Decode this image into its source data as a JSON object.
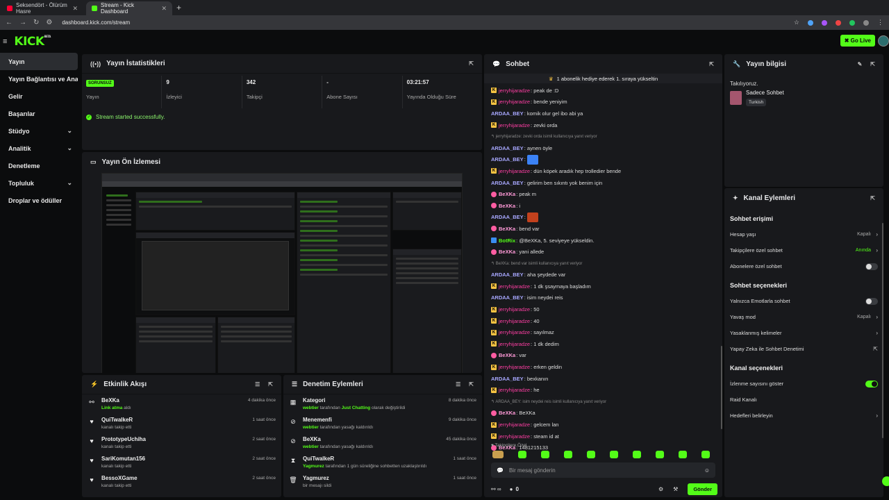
{
  "browser": {
    "tabs": [
      {
        "title": "Seksendört - Ölürüm Hasre",
        "active": false,
        "fav_color": "#ff0033"
      },
      {
        "title": "Stream - Kick Dashboard",
        "active": true,
        "fav_color": "#53fc18"
      }
    ],
    "url": "dashboard.kick.com/stream"
  },
  "topbar": {
    "logo": "KICK",
    "logo_sup": "BETA",
    "go_live": "Go Live"
  },
  "sidebar": {
    "items": [
      {
        "label": "Yayın",
        "active": true
      },
      {
        "label": "Yayın Bağlantısı ve Anahtarı"
      },
      {
        "label": "Gelir"
      },
      {
        "label": "Başarılar"
      },
      {
        "label": "Stüdyo",
        "chevron": true
      },
      {
        "label": "Analitik",
        "chevron": true
      },
      {
        "label": "Denetleme"
      },
      {
        "label": "Topluluk",
        "chevron": true
      },
      {
        "label": "Droplar ve ödüller"
      }
    ]
  },
  "stats_panel": {
    "title": "Yayın İstatistikleri",
    "stats": [
      {
        "value": "SORUNSUZ",
        "label": "Yayın"
      },
      {
        "value": "9",
        "label": "İzleyici"
      },
      {
        "value": "342",
        "label": "Takipçi"
      },
      {
        "value": "-",
        "label": "Abone Sayısı"
      },
      {
        "value": "03:21:57",
        "label": "Yayında Olduğu Süre"
      }
    ],
    "success": "Stream started successfully."
  },
  "preview_panel": {
    "title": "Yayın Ön İzlemesi"
  },
  "activity_panel": {
    "title": "Etkinlik Akışı",
    "items": [
      {
        "name": "BeXKa",
        "highlight": "Link atma",
        "sub": " aldı",
        "time": "4 dakika önce"
      },
      {
        "name": "QuiTwalkeR",
        "highlight": "",
        "sub": "kanalı takip etti",
        "time": "1 saat önce"
      },
      {
        "name": "PrototypeUchiha",
        "highlight": "",
        "sub": "kanalı takip etti",
        "time": "2 saat önce"
      },
      {
        "name": "SariKomutan156",
        "highlight": "",
        "sub": "kanalı takip etti",
        "time": "2 saat önce"
      },
      {
        "name": "BessoXGame",
        "highlight": "",
        "sub": "kanalı takip etti",
        "time": "2 saat önce"
      }
    ]
  },
  "moderation_panel": {
    "title": "Denetim Eylemleri",
    "items": [
      {
        "name": "Kategori",
        "highlight": "webtier",
        "sub": " tarafından ",
        "highlight2": "Just Chatting",
        "sub2": " olarak değiştirildi",
        "time": "8 dakika önce"
      },
      {
        "name": "Menemenfi",
        "highlight": "webtier",
        "sub": " tarafından yasağı kaldırıldı",
        "highlight2": "",
        "sub2": "",
        "time": "9 dakika önce"
      },
      {
        "name": "BeXKa",
        "highlight": "webtier",
        "sub": " tarafından yasağı kaldırıldı",
        "highlight2": "",
        "sub2": "",
        "time": "45 dakika önce"
      },
      {
        "name": "QuiTwalkeR",
        "highlight": "Yagmurez",
        "sub": " tarafından 1 gün süreliğine sohbetten uzaklaştırıldı",
        "highlight2": "",
        "sub2": "",
        "time": "1 saat önce"
      },
      {
        "name": "Yagmurez",
        "highlight": "",
        "sub": "bir mesajı sildi",
        "highlight2": "",
        "sub2": "",
        "time": "1 saat önce"
      }
    ]
  },
  "chat_panel": {
    "title": "Sohbet",
    "announcement": "1 abonelik hediye ederek 1. sıraya yükseltin",
    "messages": [
      {
        "user": "jerryhijaradze",
        "type": "j",
        "text": ": peak de :D"
      },
      {
        "user": "jerryhijaradze",
        "type": "j",
        "text": ": bende yeniyim"
      },
      {
        "user": "ARDAA_BEY",
        "type": "a",
        "text": ": komik olur gel ibo abi ya"
      },
      {
        "user": "jerryhijaradze",
        "type": "j",
        "text": ": zevki orda"
      },
      {
        "user": "",
        "type": "reply",
        "text": "↰ jerryhijaradze: zevki orda isimli kullanıcıya yanıt veriyor"
      },
      {
        "user": "ARDAA_BEY",
        "type": "a",
        "text": ": aynen öyle"
      },
      {
        "user": "ARDAA_BEY",
        "type": "a",
        "text": ":",
        "emote": "#3b82f6"
      },
      {
        "user": "jerryhijaradze",
        "type": "j",
        "text": ": dün köpek aradık hep trolledier bende"
      },
      {
        "user": "ARDAA_BEY",
        "type": "a",
        "text": ": gelirim ben sıkıntı yok benim için"
      },
      {
        "user": "BeXKa",
        "type": "b",
        "text": ": peak m"
      },
      {
        "user": "BeXKa",
        "type": "b",
        "text": ": i"
      },
      {
        "user": "ARDAA_BEY",
        "type": "a",
        "text": ":",
        "emote": "#c2411d"
      },
      {
        "user": "BeXKa",
        "type": "b",
        "text": ": bend var"
      },
      {
        "user": "BotRix",
        "type": "bot",
        "text": ": @BeXKa, 5. seviyeye yükseldin."
      },
      {
        "user": "BeXKa",
        "type": "b",
        "text": ": yani allede"
      },
      {
        "user": "",
        "type": "reply",
        "text": "↰ BeXKa: bend var isimli kullanıcıya yanıt veriyor"
      },
      {
        "user": "ARDAA_BEY",
        "type": "a",
        "text": ": aha şeydede var"
      },
      {
        "user": "jerryhijaradze",
        "type": "j",
        "text": ": 1 dk şsaymaya başladım"
      },
      {
        "user": "ARDAA_BEY",
        "type": "a",
        "text": ": isim neydei reis"
      },
      {
        "user": "jerryhijaradze",
        "type": "j",
        "text": ": 50"
      },
      {
        "user": "jerryhijaradze",
        "type": "j",
        "text": ": 40"
      },
      {
        "user": "jerryhijaradze",
        "type": "j",
        "text": ": sayılmaz"
      },
      {
        "user": "jerryhijaradze",
        "type": "j",
        "text": ": 1 dk dedim"
      },
      {
        "user": "BeXKa",
        "type": "b",
        "text": ": var"
      },
      {
        "user": "jerryhijaradze",
        "type": "j",
        "text": ": erken geldin"
      },
      {
        "user": "ARDAA_BEY",
        "type": "a",
        "text": ": bexkanın"
      },
      {
        "user": "jerryhijaradze",
        "type": "j",
        "text": ": he"
      },
      {
        "user": "",
        "type": "reply",
        "text": "↰ ARDAA_BEY: isim neydei reis isimli kullanıcıya yanıt veriyor"
      },
      {
        "user": "BeXKa",
        "type": "b",
        "text": ": BeXKa"
      },
      {
        "user": "jerryhijaradze",
        "type": "j",
        "text": ": gelcem lan"
      },
      {
        "user": "jerryhijaradze",
        "type": "j",
        "text": ": steam id at"
      },
      {
        "user": "BeXKa",
        "type": "b",
        "text": ": 1481215133"
      }
    ],
    "followers_only": "♥ Takipçilere Özel",
    "input_placeholder": "Bir mesaj gönderin",
    "viewer_count": "0",
    "send_label": "Gönder"
  },
  "info_panel": {
    "title": "Yayın bilgisi",
    "label": "Takılıyoruz.",
    "stream_title": "Sadece Sohbet",
    "tag": "Turkish"
  },
  "actions_panel": {
    "title": "Kanal Eylemleri",
    "sections": [
      {
        "title": "Sohbet erişimi",
        "rows": [
          {
            "label": "Hesap yaşı",
            "value": "Kapalı",
            "control": "chevron"
          },
          {
            "label": "Takipçilere özel sohbet",
            "value": "Anında",
            "value_green": true,
            "control": "chevron"
          },
          {
            "label": "Abonelere özel sohbet",
            "value": "",
            "control": "toggle-off"
          }
        ]
      },
      {
        "title": "Sohbet seçenekleri",
        "rows": [
          {
            "label": "Yalnızca Emotlarla sohbet",
            "value": "",
            "control": "toggle-off"
          },
          {
            "label": "Yavaş mod",
            "value": "Kapalı",
            "control": "chevron"
          },
          {
            "label": "Yasaklanmış kelimeler",
            "value": "",
            "control": "chevron"
          },
          {
            "label": "Yapay Zeka ile Sohbet Denetimi",
            "value": "",
            "control": "external"
          }
        ]
      },
      {
        "title": "Kanal seçenekleri",
        "rows": [
          {
            "label": "İzlenme sayısını göster",
            "value": "",
            "control": "toggle-on"
          },
          {
            "label": "Raid Kanalı",
            "value": "",
            "control": "none"
          },
          {
            "label": "Hedefleri belirleyin",
            "value": "",
            "control": "chevron"
          }
        ]
      }
    ]
  },
  "colors": {
    "accent": "#53fc18",
    "panel": "#18191c",
    "bg": "#0b0c0d"
  }
}
